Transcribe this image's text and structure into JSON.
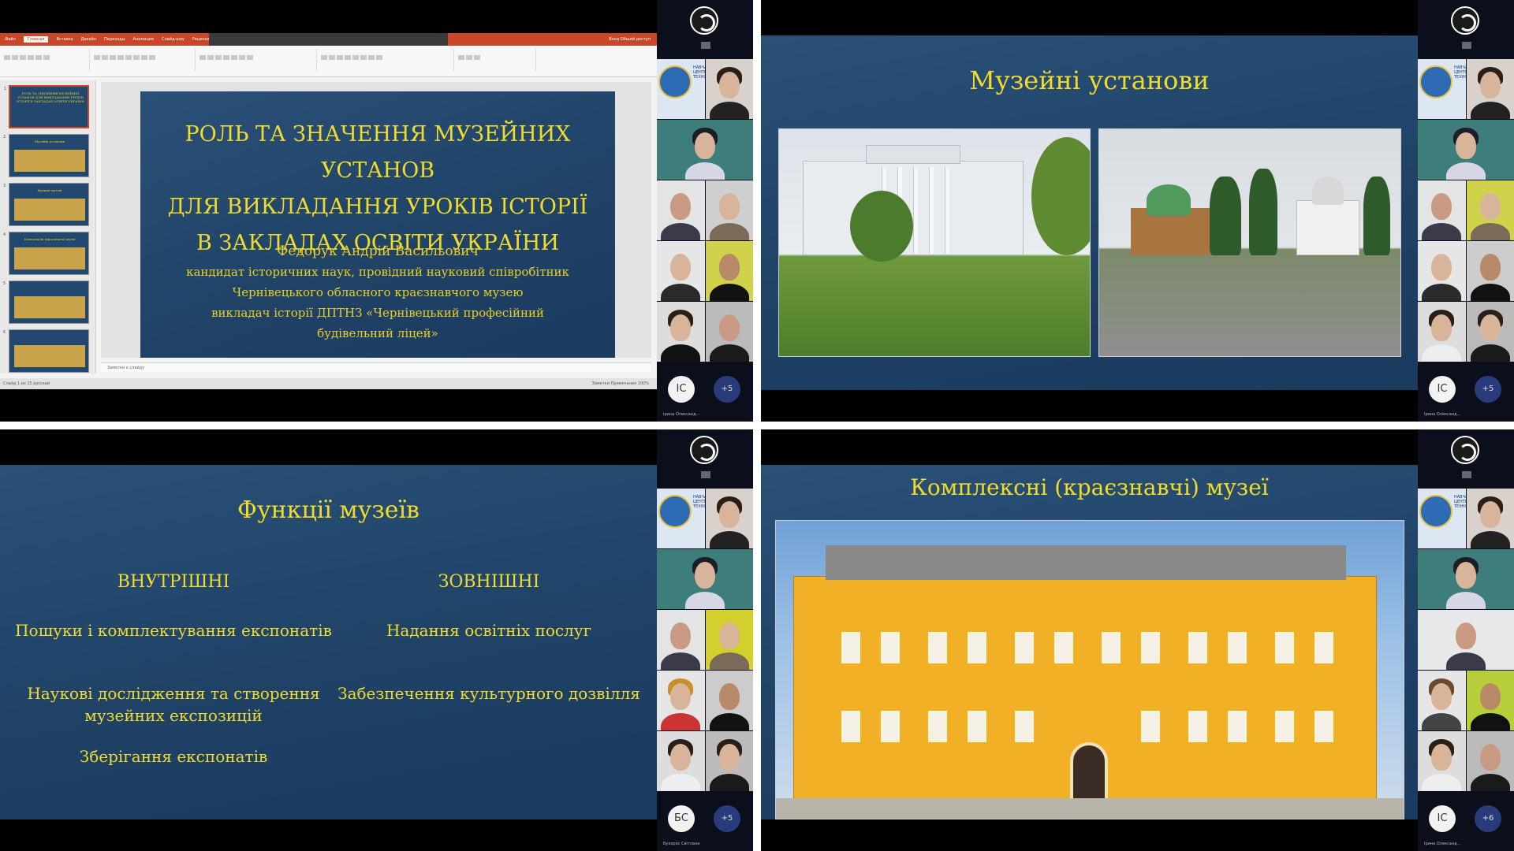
{
  "sidebar_common": {
    "app_icon": "obs-logo-icon",
    "camera_icon": "camera-off-icon",
    "more_count": "+5"
  },
  "q1": {
    "ppt": {
      "tabs": [
        "Файл",
        "Главная",
        "Вставка",
        "Дизайн",
        "Переходы",
        "Анимация",
        "Слайд-шоу",
        "Рецензирование"
      ],
      "share": "Вход  Общий доступ",
      "notes_placeholder": "Заметки к слайду",
      "status_left": "Слайд 1 из 15   русский",
      "status_right": "Заметки   Примечания",
      "zoom": "100%",
      "thumbs": [
        {
          "num": "1",
          "text": "РОЛЬ ТА ЗНАЧЕННЯ МУЗЕЙНИХ УСТАНОВ ДЛЯ ВИКЛАДАННЯ УРОКІВ ІСТОРІЇ В ЗАКЛАДАХ ОСВІТИ УКРАЇНИ"
        },
        {
          "num": "2",
          "text": "Музейні установи"
        },
        {
          "num": "3",
          "text": "Функції музеїв"
        },
        {
          "num": "4",
          "text": "Комплексні (краєзнавчі) музеї"
        },
        {
          "num": "5",
          "text": ""
        },
        {
          "num": "6",
          "text": ""
        }
      ]
    },
    "slide": {
      "title_lines": [
        "Роль та значення музейних установ",
        "для викладання уроків історії",
        "в закладах освіти України"
      ],
      "author": "Федорук Андрій Васильович",
      "info_lines": [
        "кандидат історичних наук, провідний науковий співробітник",
        "Чернівецького обласного краєзнавчого музею",
        "викладач історії ДПТНЗ «Чернівецький професійний",
        "будівельний ліцей»"
      ]
    },
    "avatar": {
      "initials": "ІС",
      "more": "+5",
      "caption": "Ірина Олександ..."
    }
  },
  "q2": {
    "heading": "Музейні установи",
    "avatar": {
      "initials": "ІС",
      "more": "+5",
      "caption": "Ірина Олександ..."
    }
  },
  "q3": {
    "heading": "Функції музеїв",
    "left_head": "ВНУТРІШНІ",
    "right_head": "ЗОВНІШНІ",
    "left_items": [
      "Пошуки і комплектування експонатів",
      "Наукові дослідження та створення музейних експозицій",
      "Зберігання експонатів"
    ],
    "right_items": [
      "Надання освітніх послуг",
      "Забезпечення культурного дозвілля"
    ],
    "avatar": {
      "initials": "БС",
      "more": "+5",
      "caption": "Бухорос Світлана"
    }
  },
  "q4": {
    "heading": "Комплексні (краєзнавчі) музеї",
    "avatar": {
      "initials": "ІС",
      "more": "+6",
      "caption": "Ірина Олександ..."
    }
  },
  "colors": {
    "slide_bg": "#1f4266",
    "slide_text": "#f1dc2a",
    "ppt_accent": "#c8472b",
    "sidebar_bg": "#0b0f1c"
  }
}
